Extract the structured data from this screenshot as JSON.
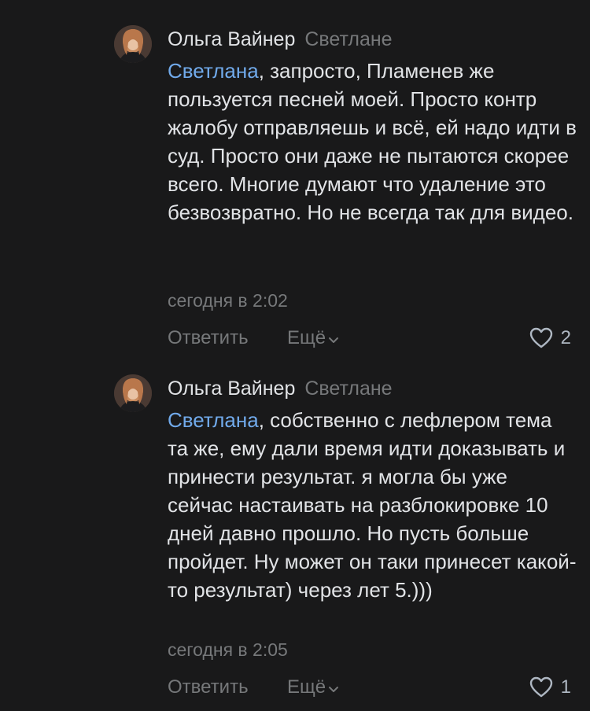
{
  "comments": [
    {
      "author": "Ольга Вайнер",
      "reply_to": "Светлане",
      "mention": "Светлана",
      "text": ", запросто, Пламенев же пользуется песней моей. Просто контр жалобу отправляешь и всё, ей надо идти в суд. Просто они даже не пытаются скорее всего. Многие думают что удаление это безвозвратно. Но не всегда так для видео.",
      "time": "сегодня в 2:02",
      "reply_label": "Ответить",
      "more_label": "Ещё",
      "likes": "2"
    },
    {
      "author": "Ольга Вайнер",
      "reply_to": "Светлане",
      "mention": "Светлана",
      "text": ", собственно с лефлером тема та же, ему дали время идти доказывать и принести результат. я могла бы уже сейчас настаивать на разблокировке 10 дней давно прошло. Но пусть больше пройдет. Ну может он таки принесет какой-то результат) через лет 5.)))",
      "time": "сегодня в 2:05",
      "reply_label": "Ответить",
      "more_label": "Ещё",
      "likes": "1"
    }
  ],
  "colors": {
    "background": "#19191a",
    "text": "#e1e3e6",
    "secondary": "#76787a",
    "link": "#71aaeb"
  },
  "icons": [
    "avatar",
    "heart-icon",
    "chevron-down-icon"
  ]
}
